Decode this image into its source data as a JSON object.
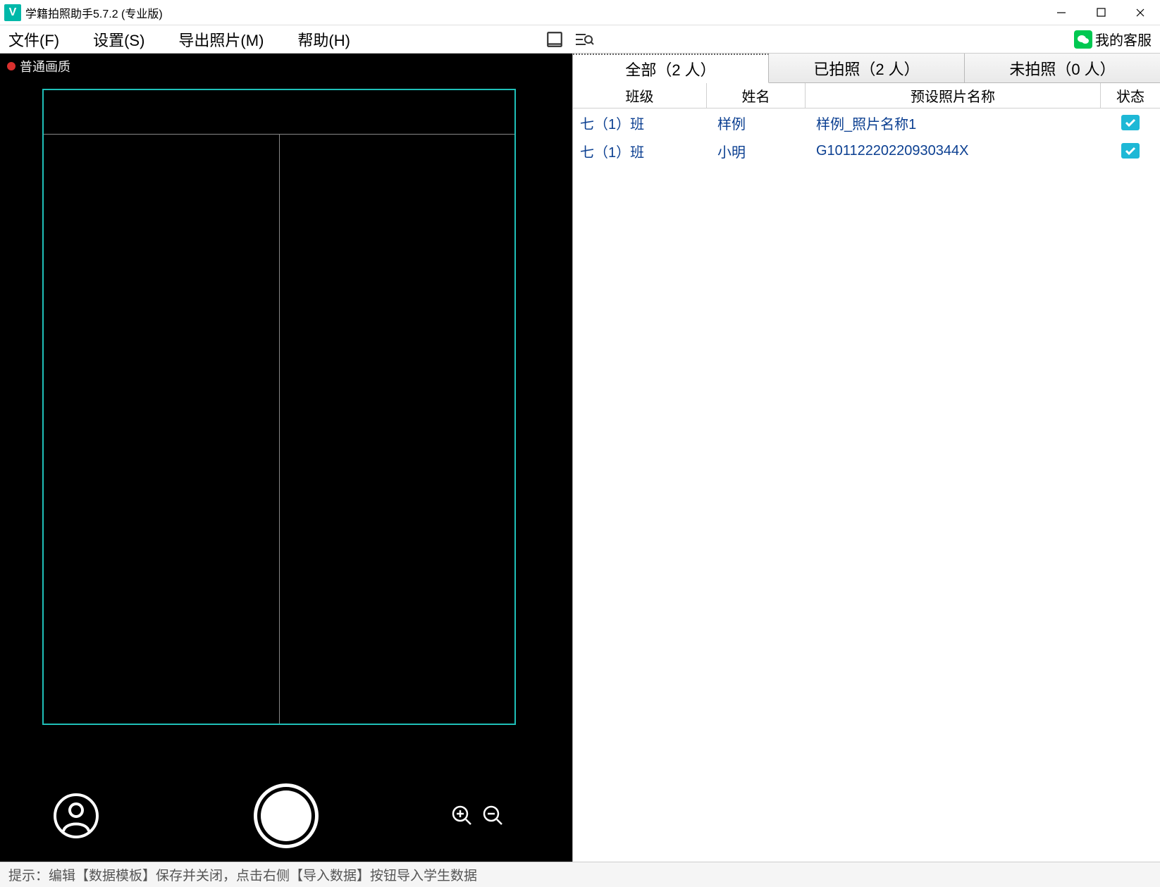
{
  "titlebar": {
    "app_icon_letter": "V",
    "title": "学籍拍照助手5.7.2 (专业版)"
  },
  "menu": {
    "file": "文件(F)",
    "settings": "设置(S)",
    "export": "导出照片(M)",
    "help": "帮助(H)",
    "customer_service": "我的客服"
  },
  "camera": {
    "quality_label": "普通画质"
  },
  "tabs": {
    "all": "全部（2 人）",
    "shot": "已拍照（2 人）",
    "unshot": "未拍照（0 人）"
  },
  "columns": {
    "class": "班级",
    "name": "姓名",
    "photo_name": "预设照片名称",
    "status": "状态"
  },
  "rows": [
    {
      "class": "七（1）班",
      "name": "样例",
      "photo_name": "样例_照片名称1",
      "status": true
    },
    {
      "class": "七（1）班",
      "name": "小明",
      "photo_name": "G10112220220930344X",
      "status": true
    }
  ],
  "statusbar": {
    "hint": "提示：编辑【数据模板】保存并关闭，点击右侧【导入数据】按钮导入学生数据"
  }
}
